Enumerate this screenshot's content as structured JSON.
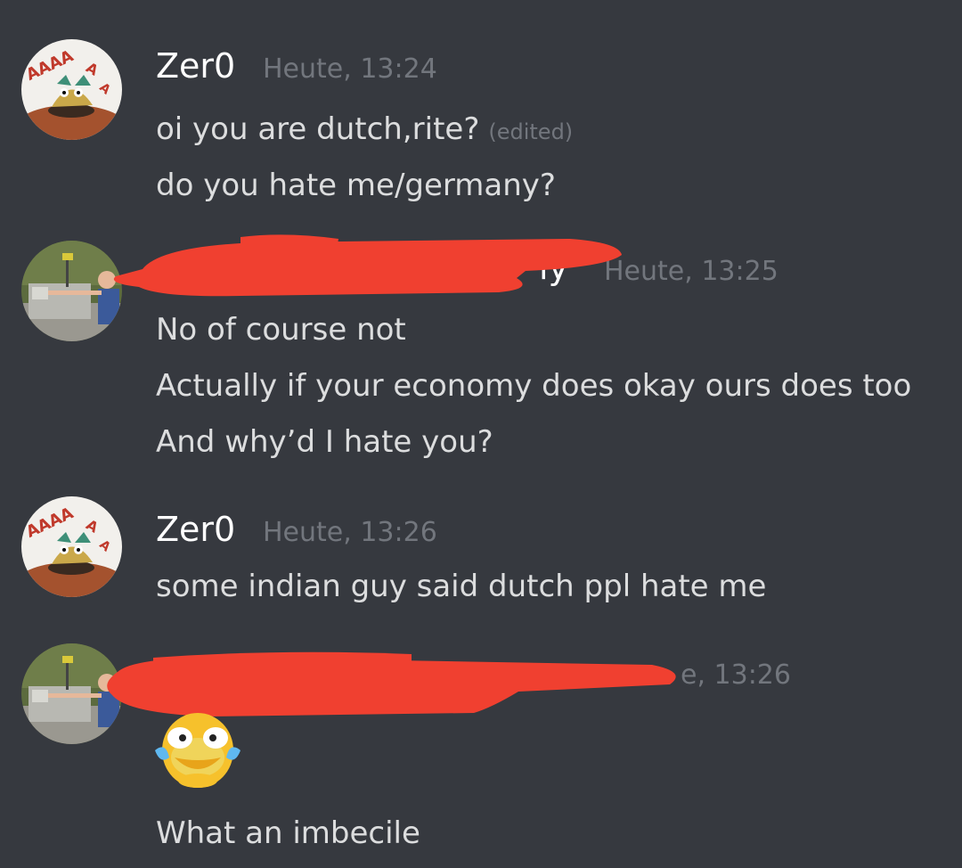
{
  "colors": {
    "background": "#36393f",
    "username": "#ffffff",
    "message": "#dcddde",
    "timestamp": "#72767d",
    "redaction": "#f04030"
  },
  "messages": [
    {
      "author": "Zer0",
      "avatar_icon": "zero-avatar-icon",
      "timestamp": "Heute, 13:24",
      "lines": [
        {
          "text": "oi you are dutch,rite?",
          "edited": "(edited)"
        },
        {
          "text": "do you hate me/germany?"
        }
      ]
    },
    {
      "author_visible_fragment": "ly",
      "author_redacted": true,
      "avatar_icon": "user-photo-avatar-icon",
      "timestamp": "Heute, 13:25",
      "lines": [
        {
          "text": "No of course not"
        },
        {
          "text": "Actually if your economy does okay ours does too"
        },
        {
          "text": "And why’d I hate you?"
        }
      ]
    },
    {
      "author": "Zer0",
      "avatar_icon": "zero-avatar-icon",
      "timestamp": "Heute, 13:26",
      "lines": [
        {
          "text": "some indian guy said dutch ppl hate me"
        }
      ]
    },
    {
      "author_redacted": true,
      "avatar_icon": "user-photo-avatar-icon",
      "timestamp_visible_fragment": "e, 13:26",
      "emoji_icon": "laughing-crying-emoji-icon",
      "lines": [
        {
          "text": "What an imbecile"
        }
      ]
    }
  ]
}
